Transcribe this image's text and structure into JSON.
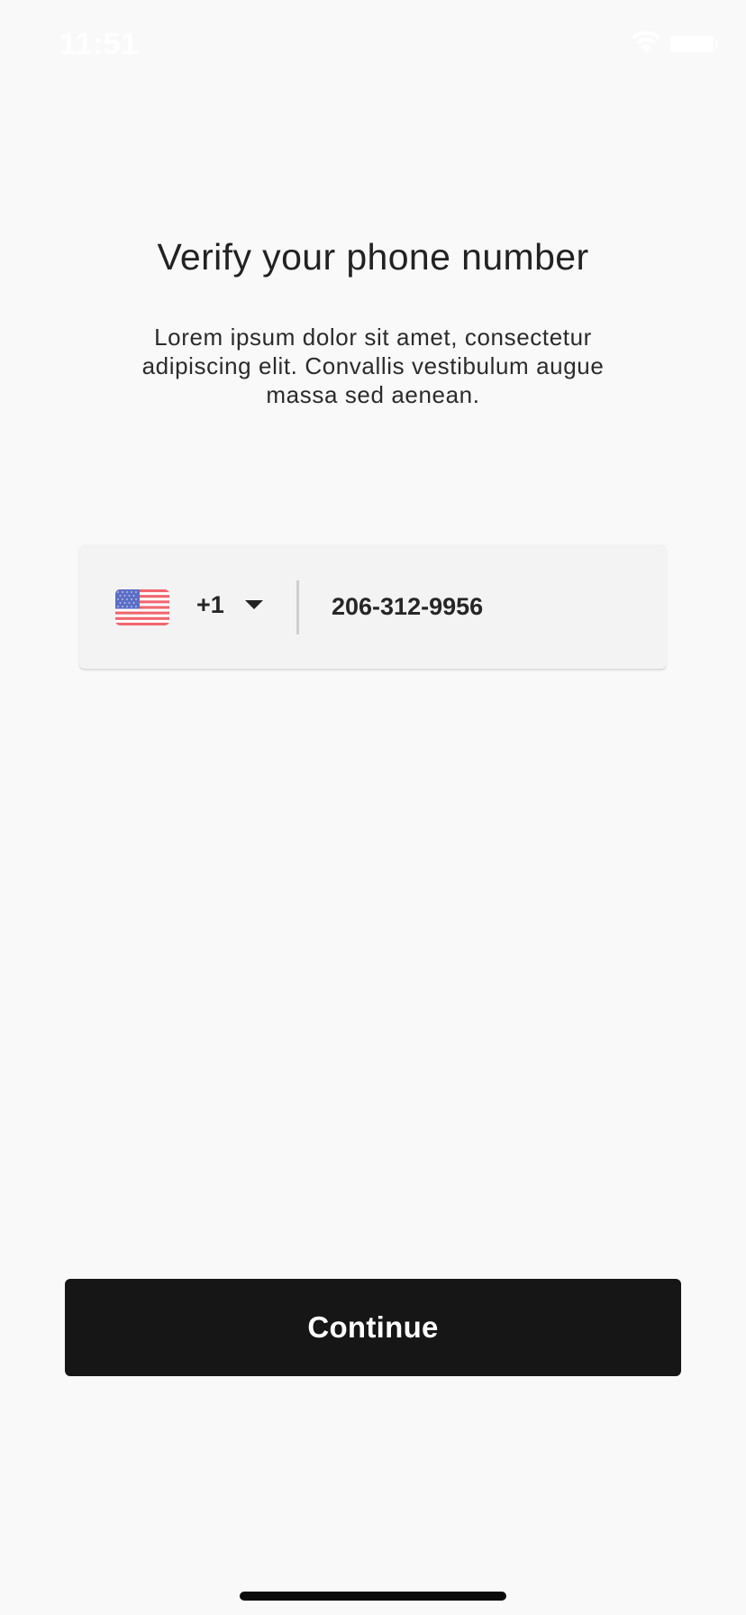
{
  "status_bar": {
    "time": "11:51",
    "icons": [
      "wifi-icon",
      "battery-icon"
    ]
  },
  "header": {
    "title": "Verify your phone number",
    "subtitle": "Lorem ipsum dolor sit amet, consectetur adipiscing elit. Convallis vestibulum augue massa sed aenean."
  },
  "phone_field": {
    "country_flag": "us-flag-icon",
    "dial_code": "+1",
    "value": "206-312-9956"
  },
  "actions": {
    "continue_label": "Continue"
  },
  "colors": {
    "background": "#f9f9f9",
    "field_background": "#f3f3f3",
    "button_background": "#161616",
    "button_text": "#ffffff",
    "text_primary": "#222222"
  }
}
